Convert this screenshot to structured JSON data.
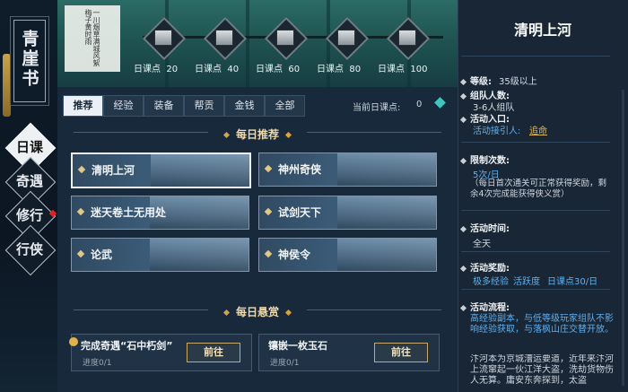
{
  "sidebar": {
    "title": "青崖书",
    "items": [
      {
        "label": "日课",
        "active": true
      },
      {
        "label": "奇遇",
        "active": false
      },
      {
        "label": "修行",
        "active": false,
        "badge": true
      },
      {
        "label": "行侠",
        "active": false
      }
    ]
  },
  "banner": {
    "poem": "一川烟草满城风絮梅子黄时雨",
    "milestones": [
      {
        "label": "日课点",
        "value": "20"
      },
      {
        "label": "日课点",
        "value": "40"
      },
      {
        "label": "日课点",
        "value": "60"
      },
      {
        "label": "日课点",
        "value": "80"
      },
      {
        "label": "日课点",
        "value": "100"
      }
    ]
  },
  "tabs": [
    "推荐",
    "经验",
    "装备",
    "帮贡",
    "金钱",
    "全部"
  ],
  "points": {
    "label": "当前日课点:",
    "value": "0"
  },
  "sections": {
    "daily": "每日推荐",
    "bounty": "每日悬赏"
  },
  "activities": [
    "清明上河",
    "神州奇侠",
    "迷天卷土无用处",
    "试剑天下",
    "论武",
    "神侯令"
  ],
  "bounties": [
    {
      "title": "完成奇遇“石中朽剑”",
      "progress": "进度0/1",
      "button": "前往"
    },
    {
      "title": "镶嵌一枚玉石",
      "progress": "进度0/1",
      "button": "前往"
    }
  ],
  "detail": {
    "title": "清明上河",
    "level_label": "等级:",
    "level_value": "35级以上",
    "party_label": "组队人数:",
    "party_value": "3-6人组队",
    "entry_label": "活动入口:",
    "entry_prefix": "活动接引人:",
    "entry_npc": "追命",
    "limit_label": "限制次数:",
    "limit_value": "5次/日",
    "limit_note": "（每日首次通关可正常获得奖励，剩余4次完成能获得侠义赏）",
    "time_label": "活动时间:",
    "time_value": "全天",
    "reward_label": "活动奖励:",
    "rewards": [
      "极多经验",
      "活跃度",
      "日课点30/日"
    ],
    "flow_label": "活动流程:",
    "flow_highlight": "高经验副本，与低等级玩家组队不影响经验获取，与落枫山庄交替开放。",
    "flow_text": "汴河本为京城漕运要道，近年来汴河上流窜起一伙江洋大盗，洗劫货物伤人无算。庸安东奔探到，太盗"
  },
  "colors": {
    "accent_gold": "#e2b54d",
    "link_blue": "#5fb0ee",
    "panel": "#17293a"
  }
}
